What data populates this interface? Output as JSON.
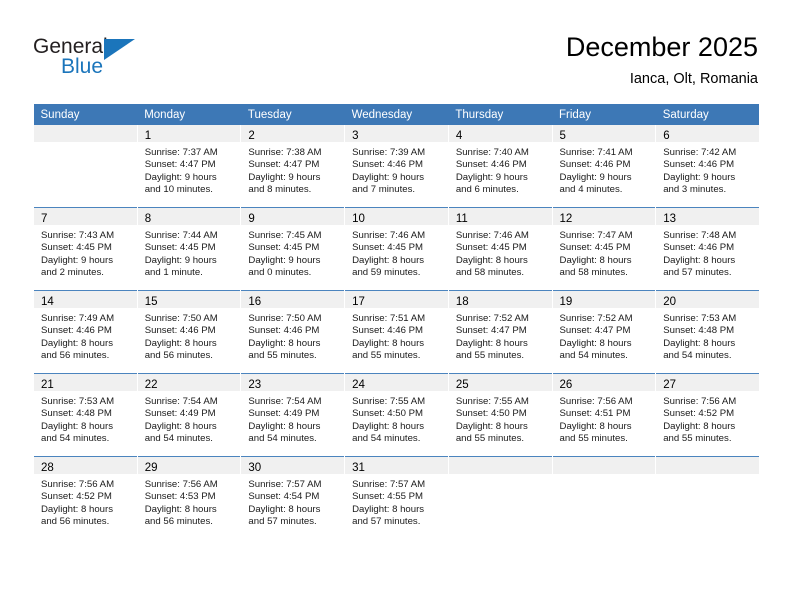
{
  "brand": {
    "name_part1": "General",
    "name_part2": "Blue",
    "flag_icon": "blue-triangle-flag",
    "color_dark": "#231f20",
    "color_blue": "#1b75bb"
  },
  "header": {
    "title": "December 2025",
    "location": "Ianca, Olt, Romania"
  },
  "calendar": {
    "header_bg": "#3d78b6",
    "daynum_bg": "#f0f0f0",
    "grid_line": "#4b84be",
    "weekdays": [
      "Sunday",
      "Monday",
      "Tuesday",
      "Wednesday",
      "Thursday",
      "Friday",
      "Saturday"
    ],
    "weeks": [
      [
        {
          "day": "",
          "lines": []
        },
        {
          "day": "1",
          "lines": [
            "Sunrise: 7:37 AM",
            "Sunset: 4:47 PM",
            "Daylight: 9 hours",
            "and 10 minutes."
          ]
        },
        {
          "day": "2",
          "lines": [
            "Sunrise: 7:38 AM",
            "Sunset: 4:47 PM",
            "Daylight: 9 hours",
            "and 8 minutes."
          ]
        },
        {
          "day": "3",
          "lines": [
            "Sunrise: 7:39 AM",
            "Sunset: 4:46 PM",
            "Daylight: 9 hours",
            "and 7 minutes."
          ]
        },
        {
          "day": "4",
          "lines": [
            "Sunrise: 7:40 AM",
            "Sunset: 4:46 PM",
            "Daylight: 9 hours",
            "and 6 minutes."
          ]
        },
        {
          "day": "5",
          "lines": [
            "Sunrise: 7:41 AM",
            "Sunset: 4:46 PM",
            "Daylight: 9 hours",
            "and 4 minutes."
          ]
        },
        {
          "day": "6",
          "lines": [
            "Sunrise: 7:42 AM",
            "Sunset: 4:46 PM",
            "Daylight: 9 hours",
            "and 3 minutes."
          ]
        }
      ],
      [
        {
          "day": "7",
          "lines": [
            "Sunrise: 7:43 AM",
            "Sunset: 4:45 PM",
            "Daylight: 9 hours",
            "and 2 minutes."
          ]
        },
        {
          "day": "8",
          "lines": [
            "Sunrise: 7:44 AM",
            "Sunset: 4:45 PM",
            "Daylight: 9 hours",
            "and 1 minute."
          ]
        },
        {
          "day": "9",
          "lines": [
            "Sunrise: 7:45 AM",
            "Sunset: 4:45 PM",
            "Daylight: 9 hours",
            "and 0 minutes."
          ]
        },
        {
          "day": "10",
          "lines": [
            "Sunrise: 7:46 AM",
            "Sunset: 4:45 PM",
            "Daylight: 8 hours",
            "and 59 minutes."
          ]
        },
        {
          "day": "11",
          "lines": [
            "Sunrise: 7:46 AM",
            "Sunset: 4:45 PM",
            "Daylight: 8 hours",
            "and 58 minutes."
          ]
        },
        {
          "day": "12",
          "lines": [
            "Sunrise: 7:47 AM",
            "Sunset: 4:45 PM",
            "Daylight: 8 hours",
            "and 58 minutes."
          ]
        },
        {
          "day": "13",
          "lines": [
            "Sunrise: 7:48 AM",
            "Sunset: 4:46 PM",
            "Daylight: 8 hours",
            "and 57 minutes."
          ]
        }
      ],
      [
        {
          "day": "14",
          "lines": [
            "Sunrise: 7:49 AM",
            "Sunset: 4:46 PM",
            "Daylight: 8 hours",
            "and 56 minutes."
          ]
        },
        {
          "day": "15",
          "lines": [
            "Sunrise: 7:50 AM",
            "Sunset: 4:46 PM",
            "Daylight: 8 hours",
            "and 56 minutes."
          ]
        },
        {
          "day": "16",
          "lines": [
            "Sunrise: 7:50 AM",
            "Sunset: 4:46 PM",
            "Daylight: 8 hours",
            "and 55 minutes."
          ]
        },
        {
          "day": "17",
          "lines": [
            "Sunrise: 7:51 AM",
            "Sunset: 4:46 PM",
            "Daylight: 8 hours",
            "and 55 minutes."
          ]
        },
        {
          "day": "18",
          "lines": [
            "Sunrise: 7:52 AM",
            "Sunset: 4:47 PM",
            "Daylight: 8 hours",
            "and 55 minutes."
          ]
        },
        {
          "day": "19",
          "lines": [
            "Sunrise: 7:52 AM",
            "Sunset: 4:47 PM",
            "Daylight: 8 hours",
            "and 54 minutes."
          ]
        },
        {
          "day": "20",
          "lines": [
            "Sunrise: 7:53 AM",
            "Sunset: 4:48 PM",
            "Daylight: 8 hours",
            "and 54 minutes."
          ]
        }
      ],
      [
        {
          "day": "21",
          "lines": [
            "Sunrise: 7:53 AM",
            "Sunset: 4:48 PM",
            "Daylight: 8 hours",
            "and 54 minutes."
          ]
        },
        {
          "day": "22",
          "lines": [
            "Sunrise: 7:54 AM",
            "Sunset: 4:49 PM",
            "Daylight: 8 hours",
            "and 54 minutes."
          ]
        },
        {
          "day": "23",
          "lines": [
            "Sunrise: 7:54 AM",
            "Sunset: 4:49 PM",
            "Daylight: 8 hours",
            "and 54 minutes."
          ]
        },
        {
          "day": "24",
          "lines": [
            "Sunrise: 7:55 AM",
            "Sunset: 4:50 PM",
            "Daylight: 8 hours",
            "and 54 minutes."
          ]
        },
        {
          "day": "25",
          "lines": [
            "Sunrise: 7:55 AM",
            "Sunset: 4:50 PM",
            "Daylight: 8 hours",
            "and 55 minutes."
          ]
        },
        {
          "day": "26",
          "lines": [
            "Sunrise: 7:56 AM",
            "Sunset: 4:51 PM",
            "Daylight: 8 hours",
            "and 55 minutes."
          ]
        },
        {
          "day": "27",
          "lines": [
            "Sunrise: 7:56 AM",
            "Sunset: 4:52 PM",
            "Daylight: 8 hours",
            "and 55 minutes."
          ]
        }
      ],
      [
        {
          "day": "28",
          "lines": [
            "Sunrise: 7:56 AM",
            "Sunset: 4:52 PM",
            "Daylight: 8 hours",
            "and 56 minutes."
          ]
        },
        {
          "day": "29",
          "lines": [
            "Sunrise: 7:56 AM",
            "Sunset: 4:53 PM",
            "Daylight: 8 hours",
            "and 56 minutes."
          ]
        },
        {
          "day": "30",
          "lines": [
            "Sunrise: 7:57 AM",
            "Sunset: 4:54 PM",
            "Daylight: 8 hours",
            "and 57 minutes."
          ]
        },
        {
          "day": "31",
          "lines": [
            "Sunrise: 7:57 AM",
            "Sunset: 4:55 PM",
            "Daylight: 8 hours",
            "and 57 minutes."
          ]
        },
        {
          "day": "",
          "lines": []
        },
        {
          "day": "",
          "lines": []
        },
        {
          "day": "",
          "lines": []
        }
      ]
    ]
  }
}
